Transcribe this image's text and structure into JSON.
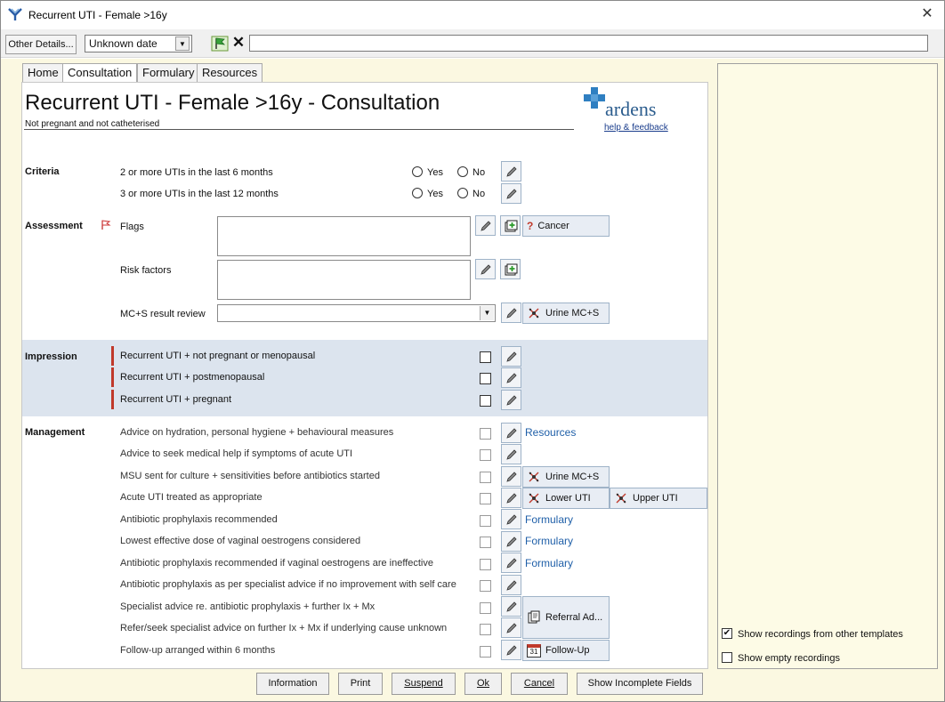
{
  "window": {
    "title": "Recurrent UTI - Female >16y",
    "close_label": "✕"
  },
  "toolbar": {
    "other_details_label": "Other Details...",
    "date_value": "Unknown date",
    "clear_label": "✕"
  },
  "tabs": [
    {
      "label": "Home"
    },
    {
      "label": "Consultation",
      "active": true
    },
    {
      "label": "Formulary"
    },
    {
      "label": "Resources"
    }
  ],
  "header": {
    "title": "Recurrent UTI - Female >16y - Consultation",
    "subtitle": "Not pregnant and not catheterised",
    "brand": "ardens",
    "help_link": "help & feedback"
  },
  "criteria": {
    "label": "Criteria",
    "rows": [
      {
        "text": "2 or more UTIs in the last 6 months",
        "yes": "Yes",
        "no": "No"
      },
      {
        "text": "3 or more UTIs in the last 12 months",
        "yes": "Yes",
        "no": "No"
      }
    ]
  },
  "assessment": {
    "label": "Assessment",
    "flags_label": "Flags",
    "cancer_button": "Cancer",
    "risk_factors_label": "Risk factors",
    "mcs_label": "MC+S result review",
    "urine_mcs_button": "Urine MC+S"
  },
  "impression": {
    "label": "Impression",
    "rows": [
      {
        "text": "Recurrent UTI + not pregnant or menopausal"
      },
      {
        "text": "Recurrent UTI + postmenopausal"
      },
      {
        "text": "Recurrent UTI + pregnant"
      }
    ]
  },
  "management": {
    "label": "Management",
    "rows": [
      {
        "text": "Advice on hydration, personal hygiene + behavioural measures"
      },
      {
        "text": "Advice to seek medical help if symptoms of acute UTI"
      },
      {
        "text": "MSU sent for culture + sensitivities before antibiotics started"
      },
      {
        "text": "Acute UTI treated as appropriate"
      },
      {
        "text": "Antibiotic prophylaxis recommended"
      },
      {
        "text": "Lowest effective dose of vaginal oestrogens considered"
      },
      {
        "text": "Antibiotic prophylaxis recommended if vaginal oestrogens are ineffective"
      },
      {
        "text": "Antibiotic prophylaxis as per specialist advice if no improvement with self care"
      },
      {
        "text": "Specialist advice re. antibiotic prophylaxis + further Ix + Mx"
      },
      {
        "text": "Refer/seek specialist advice on further Ix + Mx if underlying cause unknown"
      },
      {
        "text": "Follow-up arranged within 6 months"
      }
    ],
    "resources_link": "Resources",
    "urine_mcs_button": "Urine MC+S",
    "lower_uti_button": "Lower UTI",
    "upper_uti_button": "Upper UTI",
    "formulary_link": "Formulary",
    "referral_button": "Referral Ad...",
    "followup_button": "Follow-Up",
    "calendar_num": "31"
  },
  "right_pane": {
    "show_other_label": "Show recordings from other templates",
    "show_other_checked": true,
    "show_empty_label": "Show empty recordings",
    "show_empty_checked": false
  },
  "footer": {
    "information": "Information",
    "print": "Print",
    "suspend": "Suspend",
    "ok": "Ok",
    "cancel": "Cancel",
    "show_incomplete": "Show Incomplete Fields"
  },
  "colors": {
    "outer_background": "#fbf8e1",
    "impression_band": "#dce4ee",
    "impression_marker": "#c0392b",
    "link_blue": "#1f5fa8",
    "ardens_blue": "#2f7fc1"
  }
}
